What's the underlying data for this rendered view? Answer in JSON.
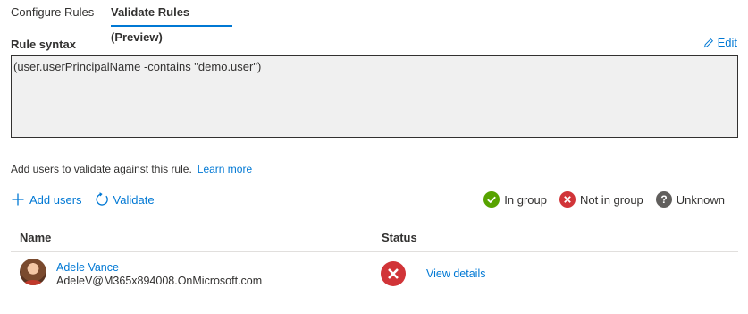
{
  "tabs": [
    {
      "label": "Configure Rules"
    },
    {
      "label": "Validate Rules (Preview)"
    }
  ],
  "rule_syntax": {
    "title": "Rule syntax",
    "edit_label": "Edit",
    "expression": "(user.userPrincipalName -contains \"demo.user\")"
  },
  "description": {
    "text": "Add users to validate against this rule.",
    "learn_more": "Learn more"
  },
  "actions": {
    "add_users": "Add users",
    "validate": "Validate"
  },
  "legend": {
    "in_group": "In group",
    "not_in_group": "Not in group",
    "unknown": "Unknown"
  },
  "colors": {
    "accent": "#0078d4",
    "in_group": "#57a300",
    "not_in_group": "#d13438",
    "unknown": "#605e5c"
  },
  "table": {
    "headers": {
      "name": "Name",
      "status": "Status"
    },
    "rows": [
      {
        "name": "Adele Vance",
        "email": "AdeleV@M365x894008.OnMicrosoft.com",
        "status_icon": "not-in-group-icon",
        "details_label": "View details"
      }
    ]
  }
}
